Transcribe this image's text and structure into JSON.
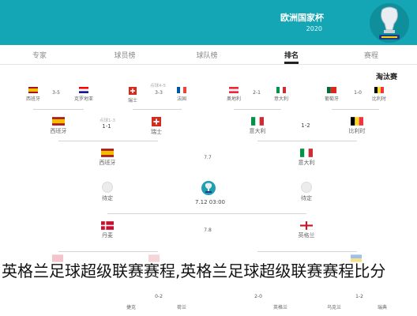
{
  "header": {
    "title": "欧洲国家杯",
    "year": "2020"
  },
  "tabs": [
    {
      "label": "赛程"
    },
    {
      "label": "排名"
    },
    {
      "label": "球队榜"
    },
    {
      "label": "球员榜"
    },
    {
      "label": "专家"
    }
  ],
  "section_label": "淘汰赛",
  "round16": [
    {
      "team": "比利时",
      "flag": "belgium"
    },
    {
      "score": "1-0"
    },
    {
      "team": "葡萄牙",
      "flag": "portugal"
    },
    {
      "team": "意大利",
      "flag": "italy"
    },
    {
      "score": "2-1"
    },
    {
      "team": "奥地利",
      "flag": "austria"
    },
    {
      "team": "法国",
      "flag": "france"
    },
    {
      "score": "3-3"
    },
    {
      "team": "瑞士",
      "flag": "switzerland"
    },
    {
      "team": "克罗地亚",
      "flag": "croatia"
    },
    {
      "score": "3-5"
    },
    {
      "team": "西班牙",
      "flag": "spain"
    }
  ],
  "penalty_note": "点球4-5",
  "quarter": [
    {
      "team": "比利时",
      "flag": "belgium"
    },
    {
      "score": "1-2"
    },
    {
      "team": "意大利",
      "flag": "italy"
    },
    {
      "team": "瑞士",
      "flag": "switzerland"
    },
    {
      "score": "1-1"
    },
    {
      "team": "西班牙",
      "flag": "spain"
    }
  ],
  "quarter_note": "点球1-3",
  "semi": {
    "left": {
      "team": "西班牙",
      "flag": "spain",
      "date": "7.7"
    },
    "right": {
      "team": "意大利",
      "flag": "italy"
    },
    "date_right": "7.7"
  },
  "final": {
    "left_team": "待定",
    "right_team": "待定",
    "datetime": "7.12 03:00"
  },
  "semi2": {
    "left": {
      "team": "丹麦",
      "flag": "denmark"
    },
    "right": {
      "team": "英格兰",
      "flag": "england"
    },
    "date": "7.8"
  },
  "bottom_row": [
    {
      "score": "0-2",
      "team": "捷克"
    },
    {
      "team": "荷兰"
    },
    {
      "score": "2-0",
      "team": "英格兰"
    },
    {
      "team": "乌克兰"
    },
    {
      "score": "1-2",
      "team": "瑞典"
    }
  ],
  "overlay_text": "英格兰足球超级联赛赛程,英格兰足球超级联赛赛程比分",
  "colors": {
    "header_bg": "#14a6b4",
    "active_tab": "#222222"
  }
}
